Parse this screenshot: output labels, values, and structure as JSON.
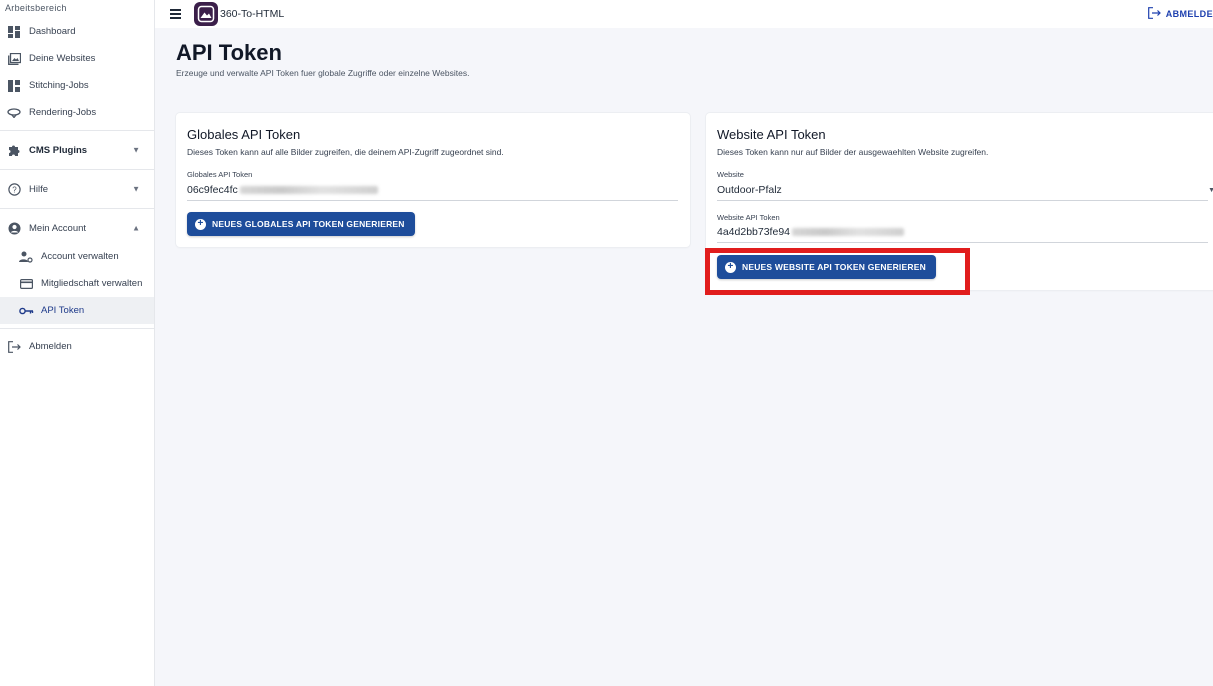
{
  "sidebar": {
    "section_label": "Arbeitsbereich",
    "items": [
      {
        "label": "Dashboard",
        "icon": "dashboard-icon"
      },
      {
        "label": "Deine Websites",
        "icon": "images-icon"
      },
      {
        "label": "Stitching-Jobs",
        "icon": "stitching-icon"
      },
      {
        "label": "Rendering-Jobs",
        "icon": "rendering-icon"
      }
    ],
    "cms_plugins": "CMS Plugins",
    "hilfe": "Hilfe",
    "mein_account": "Mein Account",
    "account_verwalten": "Account verwalten",
    "mitgliedschaft_verwalten": "Mitgliedschaft verwalten",
    "api_token": "API Token",
    "abmelden": "Abmelden"
  },
  "topbar": {
    "app_name": "360-To-HTML",
    "logout_label": "ABMELDE"
  },
  "page": {
    "title": "API Token",
    "subtitle": "Erzeuge und verwalte API Token fuer globale Zugriffe oder einzelne Websites."
  },
  "global_card": {
    "title": "Globales API Token",
    "description": "Dieses Token kann auf alle Bilder zugreifen, die deinem API-Zugriff zugeordnet sind.",
    "field_label": "Globales API Token",
    "token_prefix": "06c9fec4fc",
    "button_label": "NEUES GLOBALES API TOKEN GENERIEREN"
  },
  "website_card": {
    "title": "Website API Token",
    "description": "Dieses Token kann nur auf Bilder der ausgewaehlten Website zugreifen.",
    "website_label": "Website",
    "website_value": "Outdoor-Pfalz",
    "token_label": "Website API Token",
    "token_prefix": "4a4d2bb73fe94",
    "button_label": "NEUES WEBSITE API TOKEN GENERIEREN"
  },
  "colors": {
    "primary": "#1e4d9b",
    "highlight": "#e11d1d",
    "background": "#f5f6fa"
  }
}
